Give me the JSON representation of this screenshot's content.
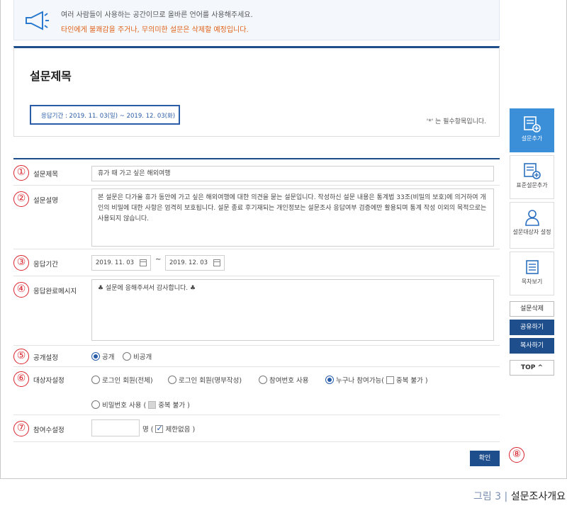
{
  "notice": {
    "line1": "여러 사람들이 사용하는 공간이므로 올바른 언어를 사용해주세요.",
    "line2": "타인에게 불쾌감을 주거나, 무의미한 설문은 삭제할 예정입니다.",
    "icon": "megaphone-icon"
  },
  "survey": {
    "title": "설문제목",
    "period": "응답기간 : 2019. 11. 03(일) ~ 2019. 12. 03(화)",
    "required_note": "'*' 는 필수항목입니다."
  },
  "form": {
    "title": {
      "num": "①",
      "label": "설문제목",
      "value": "휴가 때 가고 싶은 해외여행"
    },
    "description": {
      "num": "②",
      "label": "설문설명",
      "value": "본 설문은 다가올 휴가 동안에 가고 싶은 해외여행에 대한 의견을 묻는 설문입니다. 작성하신 설문 내용은 통계법 33조(비밀의 보호)에 의거하여 개인의 비밀에 대한 사항은 엄격히 보호됩니다. 설문 종료 후기재되는 개인정보는 설문조사 응답여부 검증에만 활용되며 통계 작성 이외의 목적으로는 사용되지 않습니다."
    },
    "period": {
      "num": "③",
      "label": "응답기간",
      "start": "2019. 11. 03",
      "end": "2019. 12. 03",
      "sep": "~"
    },
    "complete_msg": {
      "num": "④",
      "label": "응답완료메시지",
      "value": "♣ 설문에 응해주셔서 감사합니다. ♣"
    },
    "visibility": {
      "num": "⑤",
      "label": "공개설정",
      "options": [
        "공개",
        "비공개"
      ],
      "selected": 0
    },
    "target": {
      "num": "⑥",
      "label": "대상자설정",
      "opt1": "로그인 회원(전체)",
      "opt2": "로그인 회원(명부작성)",
      "opt3": "참여번호 사용",
      "opt4": "누구나 참여가능(",
      "opt4_dup": "중복 불가 )",
      "opt5": "비밀번호 사용 (",
      "opt5_dup": "중복 불가 )"
    },
    "participants": {
      "num": "⑦",
      "label": "참여수설정",
      "unit": "명 (",
      "unlimited": "제한없음 )"
    },
    "submit": {
      "label": "확인",
      "num": "⑧"
    }
  },
  "side": {
    "add": "설문추가",
    "std_add": "표준설문추가",
    "target_set": "설문대상자 설정",
    "toc": "목차보기",
    "delete": "설문삭제",
    "share": "공유하기",
    "copy": "복사하기",
    "top": "TOP ^"
  },
  "caption": {
    "fig": "그림 3 | ",
    "text": "설문조사개요"
  }
}
